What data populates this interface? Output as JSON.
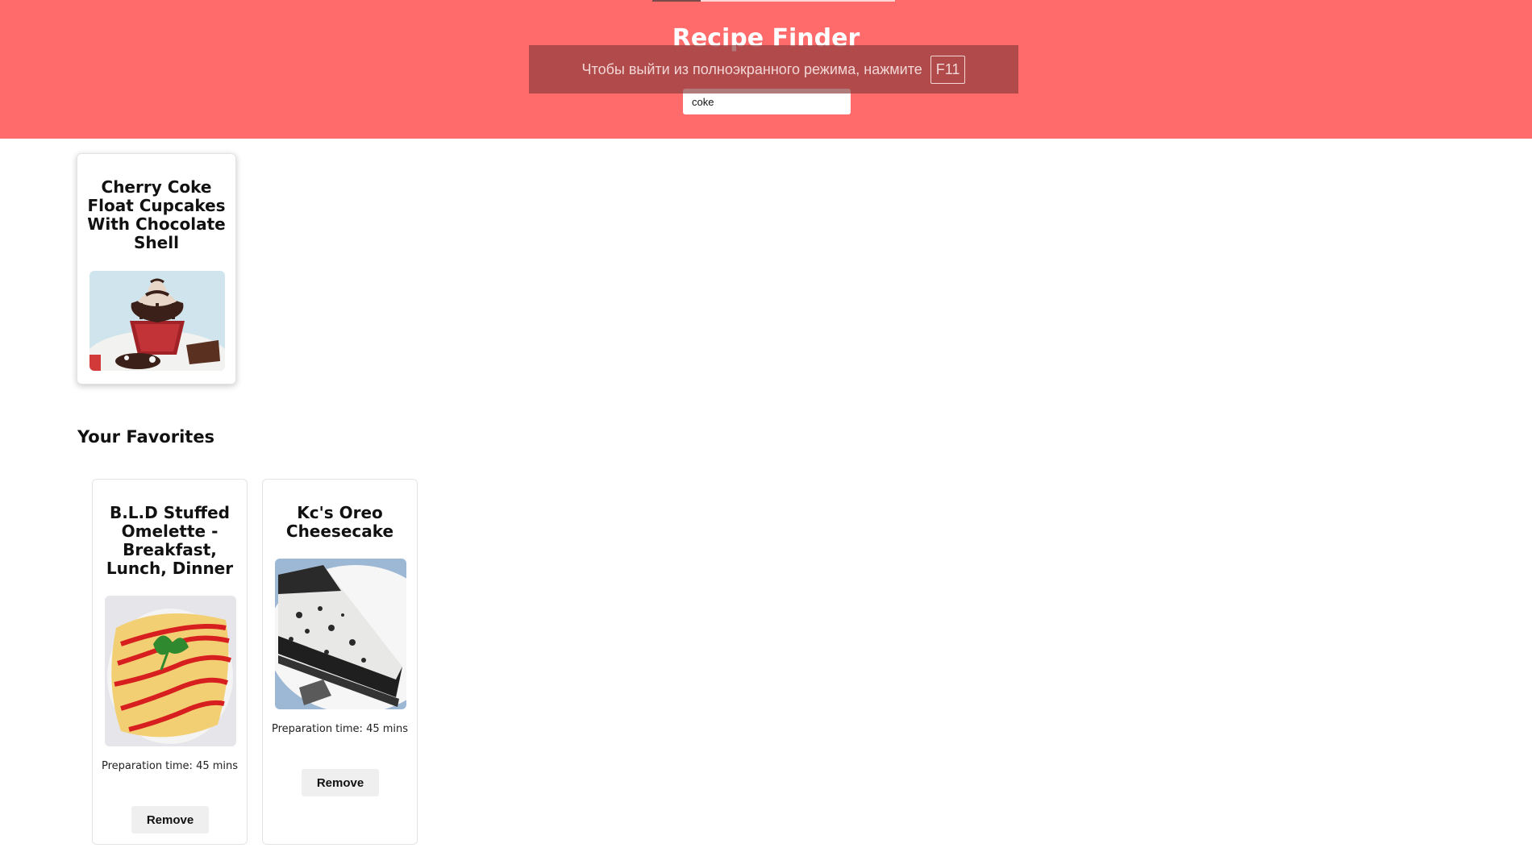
{
  "header": {
    "title": "Recipe Finder",
    "search": {
      "value": "coke",
      "placeholder": ""
    },
    "bg_color": "#ff6b6b"
  },
  "fullscreen_notice": {
    "text": "Чтобы выйти из полноэкранного режима, нажмите",
    "key": "F11"
  },
  "results": [
    {
      "title": "Cherry Coke Float Cupcakes With Chocolate Shell",
      "image_icon": "cupcake-photo"
    }
  ],
  "favorites": {
    "heading": "Your Favorites",
    "items": [
      {
        "title": "B.L.D Stuffed Omelette - Breakfast, Lunch, Dinner",
        "image_icon": "omelette-photo",
        "prep_time": "Preparation time: 45 mins",
        "remove_label": "Remove"
      },
      {
        "title": "Kc's Oreo Cheesecake",
        "image_icon": "cheesecake-photo",
        "prep_time": "Preparation time: 45 mins",
        "remove_label": "Remove"
      }
    ]
  }
}
